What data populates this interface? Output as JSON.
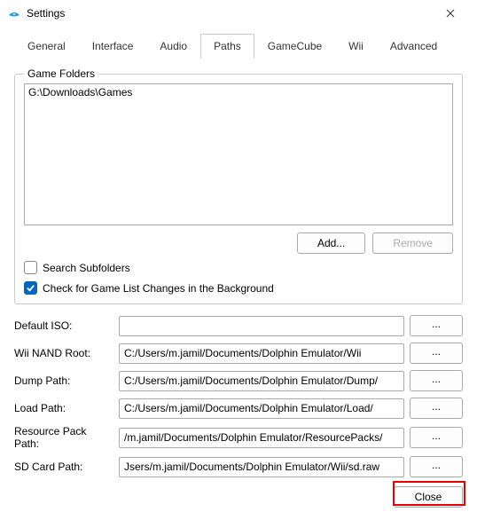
{
  "window": {
    "title": "Settings"
  },
  "tabs": {
    "items": [
      "General",
      "Interface",
      "Audio",
      "Paths",
      "GameCube",
      "Wii",
      "Advanced"
    ],
    "active": "Paths"
  },
  "gameFolders": {
    "groupLabel": "Game Folders",
    "items": [
      "G:\\Downloads\\Games"
    ],
    "addLabel": "Add...",
    "removeLabel": "Remove"
  },
  "checks": {
    "searchSubfolders": {
      "label": "Search Subfolders",
      "checked": false
    },
    "backgroundCheck": {
      "label": "Check for Game List Changes in the Background",
      "checked": true
    }
  },
  "paths": {
    "defaultIso": {
      "label": "Default ISO:",
      "value": ""
    },
    "wiiNandRoot": {
      "label": "Wii NAND Root:",
      "value": "C:/Users/m.jamil/Documents/Dolphin Emulator/Wii"
    },
    "dumpPath": {
      "label": "Dump Path:",
      "value": "C:/Users/m.jamil/Documents/Dolphin Emulator/Dump/"
    },
    "loadPath": {
      "label": "Load Path:",
      "value": "C:/Users/m.jamil/Documents/Dolphin Emulator/Load/"
    },
    "resourcePack": {
      "label": "Resource Pack Path:",
      "value": "/m.jamil/Documents/Dolphin Emulator/ResourcePacks/"
    },
    "sdCardPath": {
      "label": "SD Card Path:",
      "value": "Jsers/m.jamil/Documents/Dolphin Emulator/Wii/sd.raw"
    }
  },
  "browseLabel": "...",
  "closeLabel": "Close"
}
